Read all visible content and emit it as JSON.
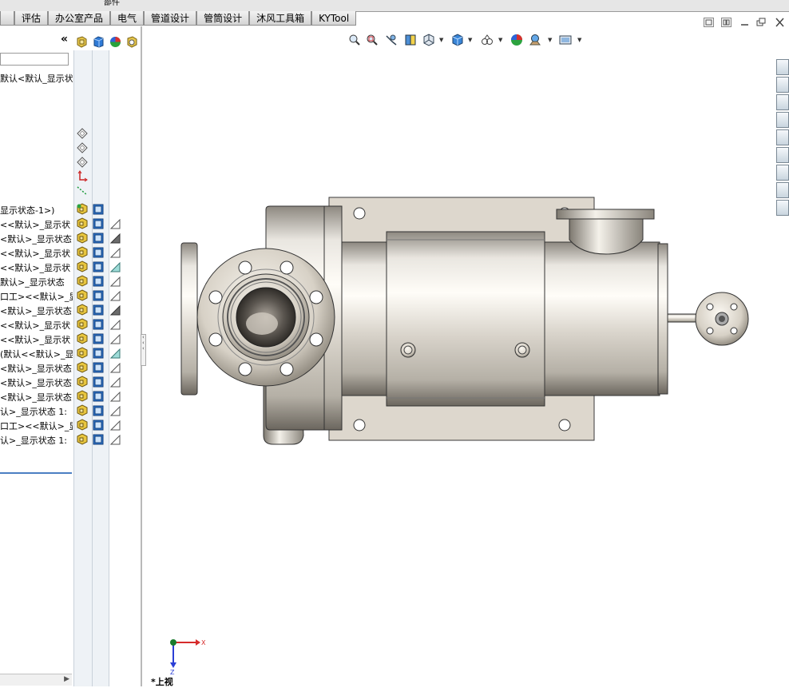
{
  "ribbon": {
    "partial_label": "部件",
    "tabs": [
      {
        "label": ""
      },
      {
        "label": "评估"
      },
      {
        "label": "办公室产品"
      },
      {
        "label": "电气"
      },
      {
        "label": "管道设计"
      },
      {
        "label": "管筒设计"
      },
      {
        "label": "沐风工具箱"
      },
      {
        "label": "KYTool"
      }
    ]
  },
  "feature_tree": {
    "collapse_glyph": "«",
    "header_icons": [
      "display-pane-assembly-icon",
      "display-mode-cube-icon",
      "appearance-sphere-icon",
      "transparency-icon"
    ],
    "filter_value": "",
    "root_label": "默认<默认_显示状",
    "items": [
      {
        "label": "显示状态-1>)",
        "row": 0,
        "yellow": true,
        "blue": true,
        "tri": ""
      },
      {
        "label": "<<默认>_显示状",
        "row": 1,
        "yellow": true,
        "blue": true,
        "tri": "outline"
      },
      {
        "label": "<默认>_显示状态",
        "row": 2,
        "yellow": true,
        "blue": true,
        "tri": "dark"
      },
      {
        "label": "<<默认>_显示状",
        "row": 3,
        "yellow": true,
        "blue": true,
        "tri": "outline"
      },
      {
        "label": "<<默认>_显示状",
        "row": 4,
        "yellow": true,
        "blue": true,
        "tri": "teal"
      },
      {
        "label": "默认>_显示状态",
        "row": 5,
        "yellow": true,
        "blue": true,
        "tri": "outline"
      },
      {
        "label": "口工><<默认>_显",
        "row": 6,
        "yellow": true,
        "blue": true,
        "tri": "outline"
      },
      {
        "label": "<默认>_显示状态",
        "row": 7,
        "yellow": true,
        "blue": true,
        "tri": "dark"
      },
      {
        "label": "<<默认>_显示状",
        "row": 8,
        "yellow": true,
        "blue": true,
        "tri": "outline"
      },
      {
        "label": "<<默认>_显示状",
        "row": 9,
        "yellow": true,
        "blue": true,
        "tri": "outline"
      },
      {
        "label": "(默认<<默认>_显",
        "row": 10,
        "yellow": true,
        "blue": true,
        "tri": "teal"
      },
      {
        "label": "<默认>_显示状态",
        "row": 11,
        "yellow": true,
        "blue": true,
        "tri": "outline"
      },
      {
        "label": "<默认>_显示状态",
        "row": 12,
        "yellow": true,
        "blue": true,
        "tri": "outline"
      },
      {
        "label": "<默认>_显示状态",
        "row": 13,
        "yellow": true,
        "blue": true,
        "tri": "outline"
      },
      {
        "label": "认>_显示状态 1:",
        "row": 14,
        "yellow": true,
        "blue": true,
        "tri": "outline"
      },
      {
        "label": "口工><<默认>_显",
        "row": 15,
        "yellow": true,
        "blue": true,
        "tri": "outline"
      },
      {
        "label": "认>_显示状态 1:",
        "row": 16,
        "yellow": true,
        "blue": true,
        "tri": "outline"
      }
    ],
    "reference_icons": [
      "front-plane-icon",
      "top-plane-icon",
      "right-plane-icon",
      "origin-icon",
      "sketch-line-icon"
    ]
  },
  "heads_up_toolbar": [
    "zoom-to-fit-icon",
    "zoom-to-area-icon",
    "previous-view-icon",
    "section-view-icon",
    "view-orientation-icon",
    "display-style-icon",
    "hide-show-items-icon",
    "edit-appearance-icon",
    "apply-scene-icon",
    "view-settings-icon"
  ],
  "window_controls": [
    "tile-icon",
    "restore-view-icon",
    "minimize-icon",
    "restore-icon",
    "close-icon"
  ],
  "task_pane": [
    "solidworks-resources-icon",
    "design-library-icon",
    "file-explorer-icon",
    "view-palette-icon",
    "appearances-icon",
    "custom-properties-icon",
    "toolbox-icon",
    "pipe-routing-icon"
  ],
  "triad": {
    "x_label": "X",
    "z_label": "Z"
  },
  "view_name": "*上视",
  "colors": {
    "accent": "#4c7fc3",
    "panel": "#eef2f6",
    "metal": "#d9d4cb"
  }
}
